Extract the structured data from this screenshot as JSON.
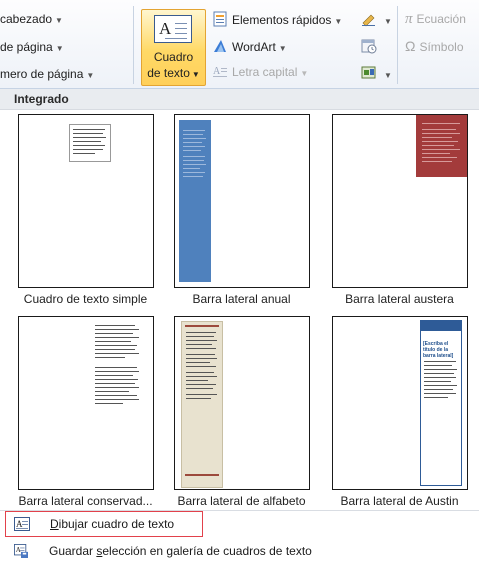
{
  "ribbon": {
    "encabezado": "cabezado",
    "pie_pagina": "de página",
    "numero_pagina": "mero de página",
    "cuadro_line1": "Cuadro",
    "cuadro_line2": "de texto",
    "elementos_rapidos": "Elementos rápidos",
    "wordart": "WordArt",
    "letra_capital": "Letra capital",
    "ecuacion": "Ecuación",
    "simbolo": "Símbolo",
    "pi_glyph": "π",
    "omega_glyph": "Ω",
    "arrow": "▼"
  },
  "gallery": {
    "section_title": "Integrado",
    "items": [
      {
        "caption": "Cuadro de texto simple"
      },
      {
        "caption": "Barra lateral anual"
      },
      {
        "caption": "Barra lateral austera"
      },
      {
        "caption": "Barra lateral conservad..."
      },
      {
        "caption": "Barra lateral de alfabeto"
      },
      {
        "caption": "Barra lateral de Austin"
      }
    ],
    "austin_heading": "[Escriba el título de la barra lateral]"
  },
  "menu": {
    "draw_prefix": "",
    "draw_accel": "D",
    "draw_rest": "ibujar cuadro de texto",
    "save_prefix": "Guardar ",
    "save_accel": "s",
    "save_rest": "elección en galería de cuadros de texto"
  },
  "colors": {
    "anual_bar": "#4f81bd",
    "austera_block": "#a33b3b",
    "alfabeto_bg": "#e8e2cf",
    "alfabeto_rule": "#9c4a3c",
    "austin_header": "#2e5b97",
    "highlight_border": "#e2414b"
  }
}
